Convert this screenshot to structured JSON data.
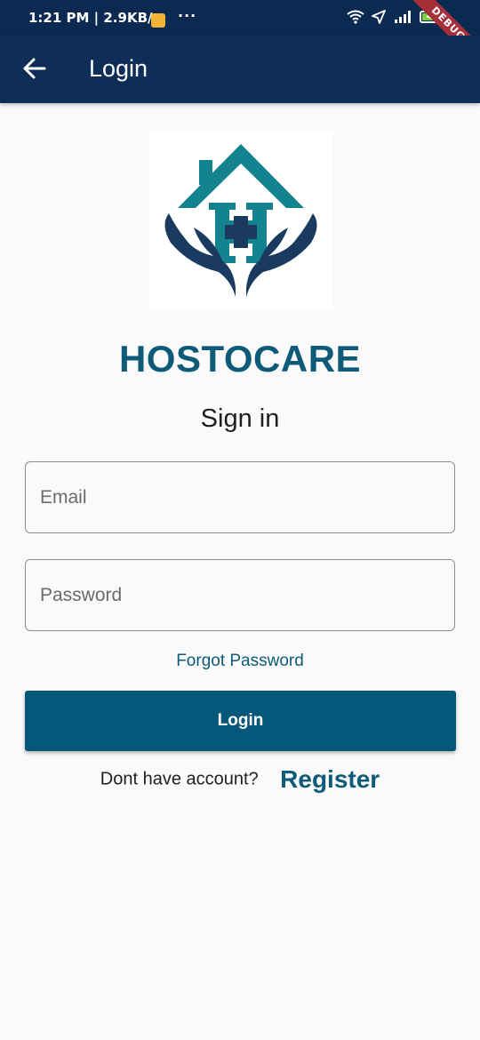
{
  "status_bar": {
    "time_speed": "1:21 PM | 2.9KB/s",
    "dots": "···",
    "battery": "40",
    "debug_banner": "DEBUG"
  },
  "app_bar": {
    "title": "Login"
  },
  "brand": {
    "name": "HOSTOCARE"
  },
  "form": {
    "heading": "Sign in",
    "email_placeholder": "Email",
    "password_placeholder": "Password",
    "forgot_label": "Forgot Password",
    "login_label": "Login"
  },
  "register": {
    "prompt": "Dont have account?",
    "link_label": "Register"
  },
  "colors": {
    "status_bar": "#0b2a52",
    "app_bar": "#0e2e57",
    "accent": "#0d5a79",
    "button": "#06587a",
    "logo_navy": "#1a3a5f",
    "logo_teal": "#13848f"
  }
}
